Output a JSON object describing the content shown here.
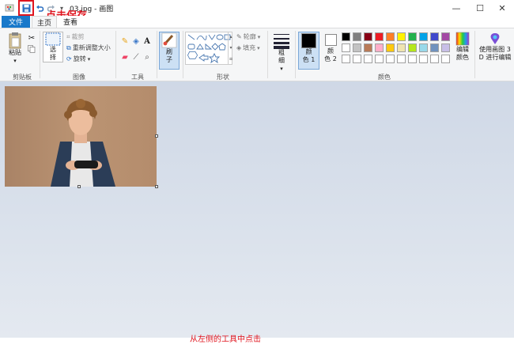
{
  "window": {
    "title": "03.jpg - 画图",
    "annotation": "点击保存",
    "bottom_annotation": "从左侧的工具中点击"
  },
  "window_controls": {
    "minimize": "—",
    "maximize": "☐",
    "close": "✕"
  },
  "tabs": [
    {
      "label": "文件"
    },
    {
      "label": "主页"
    },
    {
      "label": "查看"
    }
  ],
  "ribbon": {
    "clipboard": {
      "group": "剪贴板",
      "paste": "粘贴"
    },
    "image": {
      "group": "图像",
      "select": "选",
      "select2": "择",
      "crop": "裁剪",
      "resize": "重新调整大小",
      "rotate": "旋转"
    },
    "tools": {
      "group": "工具"
    },
    "brushes": {
      "label1": "刷",
      "label2": "子"
    },
    "shapes": {
      "group": "形状",
      "outline": "轮廓",
      "fill": "填充"
    },
    "size": {
      "label1": "粗",
      "label2": "细"
    },
    "color1": {
      "label1": "颜",
      "label2": "色 1"
    },
    "color2": {
      "label1": "颜",
      "label2": "色 2"
    },
    "colors": {
      "group": "颜色"
    },
    "edit_colors": {
      "label1": "编辑",
      "label2": "颜色"
    },
    "paint3d": {
      "label1": "使用画图 3",
      "label2": "D 进行编辑"
    }
  },
  "palette": {
    "row1": [
      "#000000",
      "#7f7f7f",
      "#880015",
      "#ed1c24",
      "#ff7f27",
      "#fff200",
      "#22b14c",
      "#00a2e8",
      "#3f48cc",
      "#a349a4"
    ],
    "row2": [
      "#ffffff",
      "#c3c3c3",
      "#b97a57",
      "#ffaec9",
      "#ffc90e",
      "#efe4b0",
      "#b5e61d",
      "#99d9ea",
      "#7092be",
      "#c8bfe7"
    ]
  },
  "accent": {
    "file_tab": "#1979ca",
    "annotation": "#e0141e"
  }
}
